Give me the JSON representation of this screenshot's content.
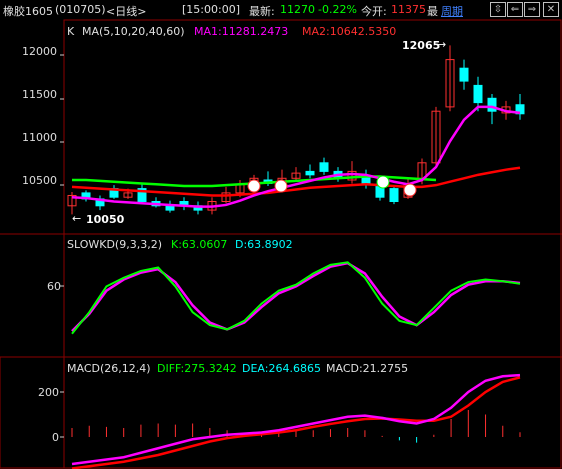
{
  "header": {
    "symbol": "橡胶1605",
    "code": "(010705)",
    "period": "<日线>",
    "time": "[15:00:00]",
    "latest_label": "最新:",
    "latest_value": "11270",
    "change_pct": "-0.22%",
    "open_label": "今开:",
    "open_value": "11375",
    "high_label": "最",
    "period_link": "周期",
    "buttons": [
      "⇳",
      "⇐",
      "⇒",
      "✕"
    ]
  },
  "colors": {
    "bg": "#000000",
    "grid": "#8b0000",
    "axis_text": "#e0e0e0",
    "up": "#ff3030",
    "down": "#00ffff",
    "ma1": "#ff00ff",
    "ma2": "#ff0000",
    "ma3": "#00ff00",
    "k": "#00ff00",
    "d": "#ff00ff",
    "accent": "#00ff00"
  },
  "price_panel": {
    "label": "K",
    "ma_label": "MA(5,10,20,40,60)",
    "ma1_label": "MA1:11281.2473",
    "ma2_label": "MA2:10642.5350",
    "high_annotation": "12065",
    "low_annotation": "10050",
    "y_ticks": [
      "12000",
      "11500",
      "11000",
      "10500"
    ]
  },
  "kd_panel": {
    "label": "SLOWKD(9,3,3,2)",
    "k_label": "K:63.0607",
    "d_label": "D:63.8902",
    "y_ticks": [
      "60"
    ]
  },
  "macd_panel": {
    "label": "MACD(26,12,4)",
    "diff_label": "DIFF:275.3242",
    "dea_label": "DEA:264.6865",
    "macd_label": "MACD:21.2755",
    "y_ticks": [
      "200",
      "0"
    ]
  },
  "chart_data": {
    "type": "candlestick",
    "candles": [
      {
        "o": 10200,
        "c": 10320,
        "h": 10360,
        "l": 10100
      },
      {
        "o": 10350,
        "c": 10280,
        "h": 10380,
        "l": 10250
      },
      {
        "o": 10280,
        "c": 10200,
        "h": 10320,
        "l": 10150
      },
      {
        "o": 10400,
        "c": 10300,
        "h": 10440,
        "l": 10280
      },
      {
        "o": 10300,
        "c": 10350,
        "h": 10400,
        "l": 10280
      },
      {
        "o": 10400,
        "c": 10250,
        "h": 10460,
        "l": 10230
      },
      {
        "o": 10250,
        "c": 10200,
        "h": 10300,
        "l": 10180
      },
      {
        "o": 10200,
        "c": 10150,
        "h": 10260,
        "l": 10120
      },
      {
        "o": 10250,
        "c": 10200,
        "h": 10300,
        "l": 10150
      },
      {
        "o": 10200,
        "c": 10150,
        "h": 10250,
        "l": 10100
      },
      {
        "o": 10150,
        "c": 10250,
        "h": 10300,
        "l": 10100
      },
      {
        "o": 10250,
        "c": 10350,
        "h": 10420,
        "l": 10230
      },
      {
        "o": 10350,
        "c": 10450,
        "h": 10500,
        "l": 10300
      },
      {
        "o": 10420,
        "c": 10520,
        "h": 10560,
        "l": 10380
      },
      {
        "o": 10500,
        "c": 10460,
        "h": 10600,
        "l": 10430
      },
      {
        "o": 10460,
        "c": 10520,
        "h": 10620,
        "l": 10420
      },
      {
        "o": 10520,
        "c": 10580,
        "h": 10650,
        "l": 10480
      },
      {
        "o": 10600,
        "c": 10560,
        "h": 10680,
        "l": 10520
      },
      {
        "o": 10700,
        "c": 10600,
        "h": 10760,
        "l": 10560
      },
      {
        "o": 10600,
        "c": 10520,
        "h": 10650,
        "l": 10480
      },
      {
        "o": 10500,
        "c": 10600,
        "h": 10720,
        "l": 10460
      },
      {
        "o": 10550,
        "c": 10450,
        "h": 10620,
        "l": 10400
      },
      {
        "o": 10450,
        "c": 10300,
        "h": 10500,
        "l": 10260
      },
      {
        "o": 10400,
        "c": 10250,
        "h": 10430,
        "l": 10220
      },
      {
        "o": 10300,
        "c": 10450,
        "h": 10520,
        "l": 10280
      },
      {
        "o": 10500,
        "c": 10700,
        "h": 10750,
        "l": 10450
      },
      {
        "o": 10700,
        "c": 11300,
        "h": 11350,
        "l": 10650
      },
      {
        "o": 11350,
        "c": 11900,
        "h": 12065,
        "l": 11300
      },
      {
        "o": 11800,
        "c": 11650,
        "h": 11900,
        "l": 11550
      },
      {
        "o": 11600,
        "c": 11400,
        "h": 11700,
        "l": 11300
      },
      {
        "o": 11450,
        "c": 11300,
        "h": 11500,
        "l": 11150
      },
      {
        "o": 11280,
        "c": 11350,
        "h": 11420,
        "l": 11200
      },
      {
        "o": 11375,
        "c": 11270,
        "h": 11500,
        "l": 11200
      }
    ],
    "ma1": [
      10300,
      10290,
      10270,
      10250,
      10240,
      10230,
      10220,
      10210,
      10200,
      10190,
      10190,
      10210,
      10260,
      10320,
      10370,
      10410,
      10450,
      10490,
      10530,
      10560,
      10570,
      10560,
      10520,
      10480,
      10450,
      10500,
      10650,
      10950,
      11200,
      11350,
      11350,
      11300,
      11281
    ],
    "ma2": [
      10420,
      10410,
      10400,
      10390,
      10380,
      10370,
      10360,
      10350,
      10340,
      10330,
      10320,
      10320,
      10330,
      10340,
      10350,
      10370,
      10390,
      10410,
      10420,
      10430,
      10440,
      10450,
      10440,
      10430,
      10420,
      10420,
      10440,
      10480,
      10520,
      10560,
      10590,
      10620,
      10642
    ],
    "ma3": [
      10500,
      10500,
      10490,
      10480,
      10470,
      10460,
      10450,
      10440,
      10430,
      10430,
      10430,
      10440,
      10450,
      10460,
      10470,
      10480,
      10490,
      10500,
      10510,
      10520,
      10530,
      10540,
      10540,
      10530,
      10520,
      10510,
      10500,
      null,
      null,
      null,
      null,
      null,
      null
    ],
    "kd_k": [
      5,
      30,
      60,
      70,
      78,
      82,
      60,
      30,
      15,
      10,
      20,
      40,
      55,
      62,
      75,
      85,
      88,
      70,
      40,
      20,
      15,
      35,
      55,
      65,
      68,
      66,
      63
    ],
    "kd_d": [
      8,
      28,
      55,
      68,
      76,
      80,
      65,
      38,
      18,
      10,
      18,
      36,
      52,
      60,
      72,
      83,
      87,
      75,
      48,
      25,
      15,
      30,
      50,
      62,
      66,
      66,
      64
    ],
    "macd_diff": [
      -120,
      -110,
      -100,
      -90,
      -70,
      -50,
      -30,
      -10,
      0,
      10,
      15,
      20,
      30,
      45,
      60,
      75,
      90,
      95,
      85,
      70,
      60,
      80,
      130,
      200,
      250,
      270,
      275
    ],
    "macd_dea": [
      -140,
      -130,
      -120,
      -110,
      -95,
      -80,
      -60,
      -40,
      -20,
      -5,
      5,
      12,
      20,
      30,
      45,
      58,
      70,
      80,
      82,
      78,
      72,
      72,
      90,
      140,
      200,
      245,
      265
    ],
    "macd_bar": [
      40,
      50,
      45,
      40,
      55,
      60,
      55,
      60,
      40,
      30,
      20,
      15,
      20,
      30,
      30,
      35,
      40,
      30,
      5,
      -15,
      -25,
      10,
      80,
      120,
      100,
      50,
      21
    ]
  }
}
